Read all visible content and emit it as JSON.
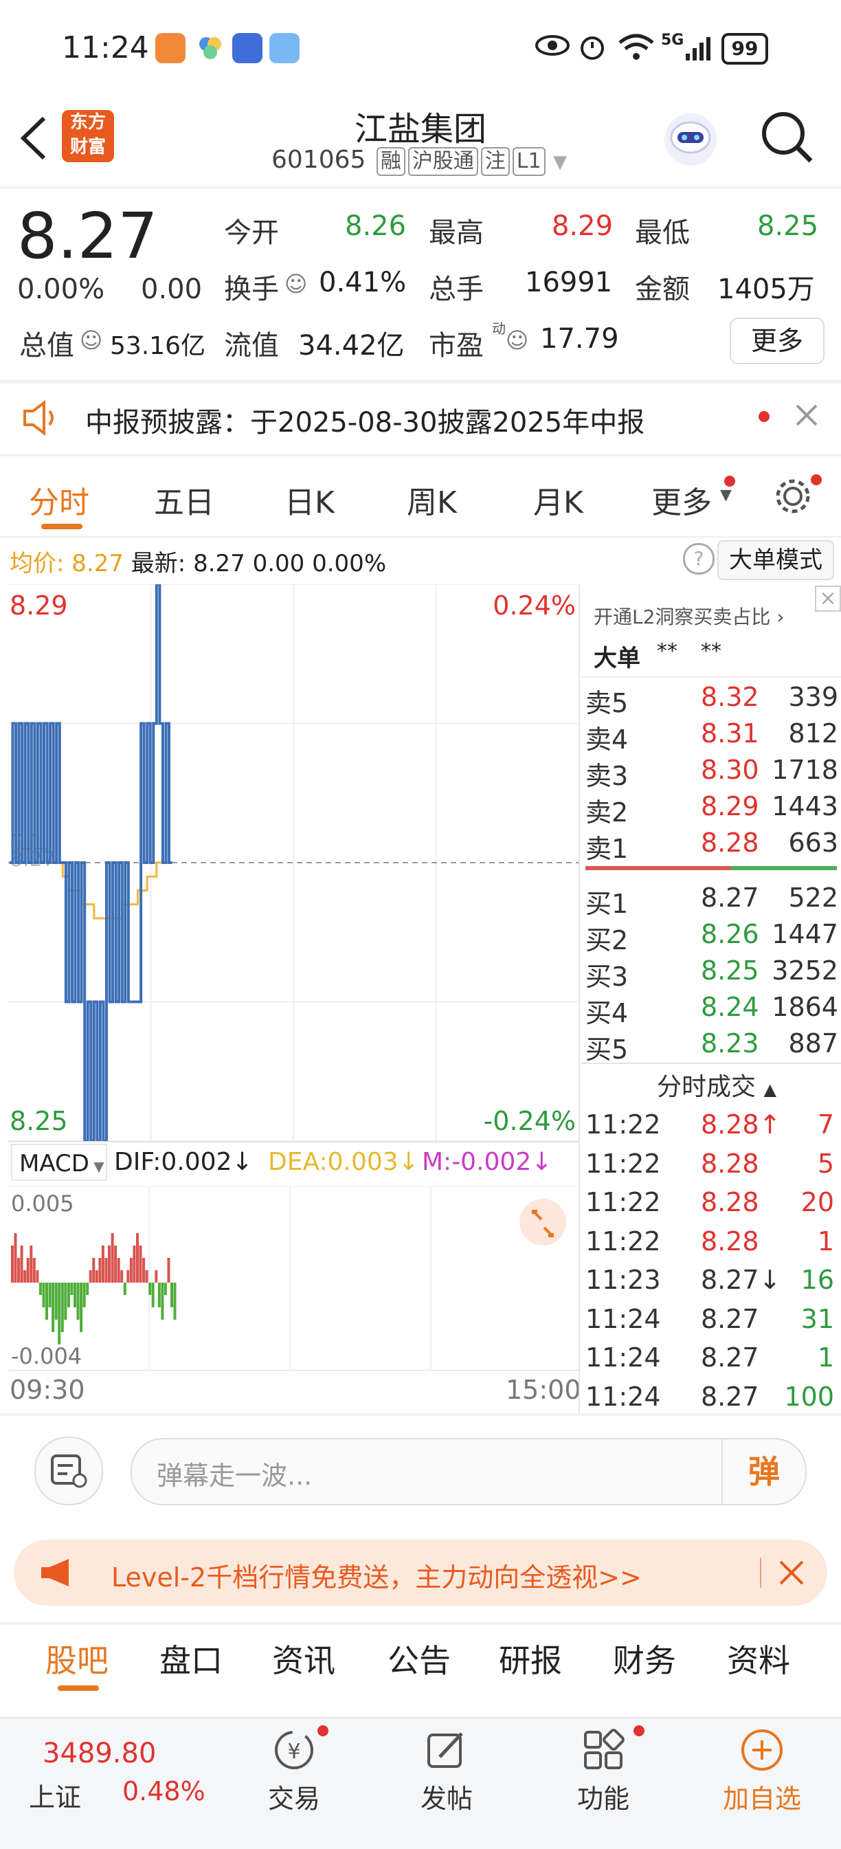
{
  "status": {
    "time": "11:24",
    "network": "5G",
    "battery": "99"
  },
  "header": {
    "title": "江盐集团",
    "code": "601065",
    "tags": [
      "融",
      "沪股通",
      "注",
      "L1"
    ],
    "logo_text": "东方财富"
  },
  "quote": {
    "price": "8.27",
    "change_pct": "0.00%",
    "change": "0.00",
    "open_label": "今开",
    "open": "8.26",
    "high_label": "最高",
    "high": "8.29",
    "low_label": "最低",
    "low": "8.25",
    "turnover_label": "换手",
    "turnover": "0.41%",
    "volume_label": "总手",
    "volume": "16991",
    "amount_label": "金额",
    "amount": "1405万",
    "mktcap_label": "总值",
    "mktcap": "53.16亿",
    "float_label": "流值",
    "float": "34.42亿",
    "pe_label": "市盈",
    "pe_sup": "动",
    "pe": "17.79",
    "more_label": "更多"
  },
  "notice": {
    "text": "中报预披露：于2025-08-30披露2025年中报"
  },
  "chart_tabs": [
    "分时",
    "五日",
    "日K",
    "周K",
    "月K",
    "更多"
  ],
  "info_line": {
    "avg_label": "均价:",
    "avg": "8.27",
    "latest_label": "最新:",
    "latest": "8.27",
    "chg": "0.00",
    "pct": "0.00%",
    "mode_btn": "大单模式"
  },
  "chart_data": {
    "type": "line",
    "y_max_label": "8.29",
    "y_min_label": "8.25",
    "y_mid_label": "8.27",
    "pct_max_label": "0.24%",
    "pct_min_label": "-0.24%",
    "x_start": "09:30",
    "x_end": "15:00",
    "ylim": [
      8.25,
      8.29
    ],
    "price_series": [
      8.27,
      8.28,
      8.27,
      8.28,
      8.27,
      8.28,
      8.27,
      8.28,
      8.27,
      8.28,
      8.27,
      8.28,
      8.27,
      8.28,
      8.27,
      8.28,
      8.27,
      8.27,
      8.26,
      8.27,
      8.26,
      8.27,
      8.26,
      8.27,
      8.25,
      8.26,
      8.25,
      8.26,
      8.25,
      8.26,
      8.25,
      8.27,
      8.26,
      8.27,
      8.26,
      8.27,
      8.26,
      8.27,
      8.26,
      8.26,
      8.26,
      8.26,
      8.28,
      8.27,
      8.28,
      8.27,
      8.28,
      8.29,
      8.28,
      8.27,
      8.28,
      8.27,
      8.27
    ],
    "avg_series": [
      8.27,
      8.272,
      8.271,
      8.272,
      8.271,
      8.271,
      8.271,
      8.272,
      8.271,
      8.271,
      8.271,
      8.271,
      8.27,
      8.27,
      8.27,
      8.27,
      8.27,
      8.269,
      8.269,
      8.268,
      8.268,
      8.268,
      8.268,
      8.267,
      8.267,
      8.267,
      8.267,
      8.266,
      8.266,
      8.266,
      8.266,
      8.266,
      8.266,
      8.266,
      8.266,
      8.266,
      8.267,
      8.267,
      8.267,
      8.267,
      8.267,
      8.268,
      8.268,
      8.268,
      8.269,
      8.269,
      8.269,
      8.27,
      8.27,
      8.27,
      8.27,
      8.27,
      8.27
    ],
    "macd": {
      "label": "MACD",
      "dif_label": "DIF:0.002↓",
      "dea_label": "DEA:0.003↓",
      "m_label": "M:-0.002↓",
      "top_label": "0.005",
      "bottom_label": "-0.004",
      "bars": [
        3,
        4,
        2,
        3,
        1,
        2,
        3,
        2,
        1,
        -1,
        -2,
        -3,
        -2,
        -4,
        -3,
        -5,
        -4,
        -3,
        -2,
        -1,
        -2,
        -3,
        -4,
        -2,
        -1,
        1,
        2,
        1,
        2,
        3,
        2,
        3,
        4,
        3,
        2,
        1,
        -1,
        1,
        2,
        3,
        4,
        3,
        2,
        1,
        -1,
        -2,
        1,
        -2,
        -3,
        -1,
        2,
        -2,
        -3
      ]
    }
  },
  "orderbook": {
    "header": "开通L2洞察买卖占比",
    "big_label": "大单",
    "big_vals": [
      "**",
      "**"
    ],
    "asks": [
      {
        "label": "卖5",
        "price": "8.32",
        "vol": "339"
      },
      {
        "label": "卖4",
        "price": "8.31",
        "vol": "812"
      },
      {
        "label": "卖3",
        "price": "8.30",
        "vol": "1718"
      },
      {
        "label": "卖2",
        "price": "8.29",
        "vol": "1443"
      },
      {
        "label": "卖1",
        "price": "8.28",
        "vol": "663"
      }
    ],
    "bids": [
      {
        "label": "买1",
        "price": "8.27",
        "vol": "522"
      },
      {
        "label": "买2",
        "price": "8.26",
        "vol": "1447"
      },
      {
        "label": "买3",
        "price": "8.25",
        "vol": "3252"
      },
      {
        "label": "买4",
        "price": "8.24",
        "vol": "1864"
      },
      {
        "label": "买5",
        "price": "8.23",
        "vol": "887"
      }
    ],
    "trades_title": "分时成交",
    "trades": [
      {
        "time": "11:22",
        "price": "8.28↑",
        "vol": "7",
        "c": "red",
        "vc": "red"
      },
      {
        "time": "11:22",
        "price": "8.28",
        "vol": "5",
        "c": "red",
        "vc": "red"
      },
      {
        "time": "11:22",
        "price": "8.28",
        "vol": "20",
        "c": "red",
        "vc": "red"
      },
      {
        "time": "11:22",
        "price": "8.28",
        "vol": "1",
        "c": "red",
        "vc": "red"
      },
      {
        "time": "11:23",
        "price": "8.27↓",
        "vol": "16",
        "c": "gray",
        "vc": "green"
      },
      {
        "time": "11:24",
        "price": "8.27",
        "vol": "31",
        "c": "gray",
        "vc": "green"
      },
      {
        "time": "11:24",
        "price": "8.27",
        "vol": "1",
        "c": "gray",
        "vc": "green"
      },
      {
        "time": "11:24",
        "price": "8.27",
        "vol": "100",
        "c": "gray",
        "vc": "green"
      }
    ]
  },
  "danmu": {
    "placeholder": "弹幕走一波...",
    "send": "弹"
  },
  "banner": {
    "text": "Level-2千档行情免费送，主力动向全透视>>"
  },
  "section_tabs": [
    "股吧",
    "盘口",
    "资讯",
    "公告",
    "研报",
    "财务",
    "资料"
  ],
  "bottom_nav": {
    "index_value": "3489.80",
    "index_name": "上证",
    "index_pct": "0.48%",
    "items": [
      "交易",
      "发帖",
      "功能",
      "加自选"
    ]
  },
  "colors": {
    "accent": "#e7771f",
    "up": "#e0332f",
    "down": "#2e9b3f",
    "price_line": "#3d6fb6",
    "avg_line": "#f0b73a"
  }
}
